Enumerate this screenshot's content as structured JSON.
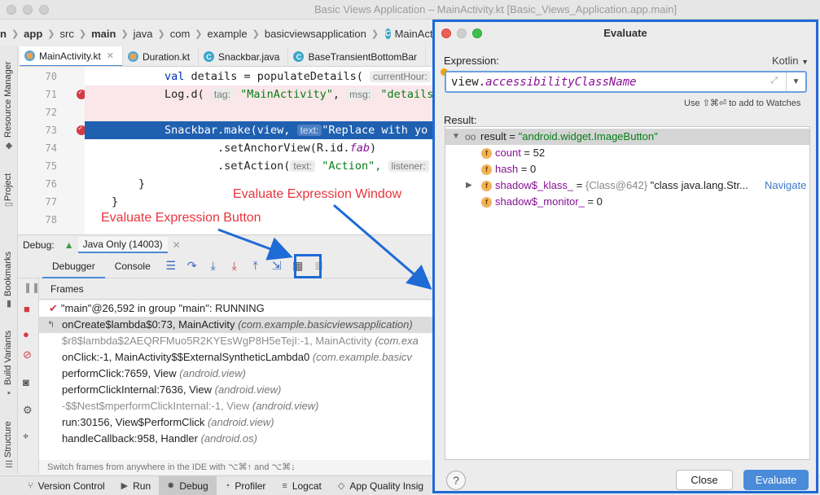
{
  "window": {
    "title": "Basic Views Application – MainActivity.kt [Basic_Views_Application.app.main]"
  },
  "breadcrumb": [
    "n",
    "app",
    "src",
    "main",
    "java",
    "com",
    "example",
    "basicviewsapplication",
    "MainActivity"
  ],
  "tabs": [
    {
      "label": "MainActivity.kt",
      "icon": "kotlin-file-icon",
      "active": true
    },
    {
      "label": "Duration.kt",
      "icon": "kotlin-file-icon",
      "active": false
    },
    {
      "label": "Snackbar.java",
      "icon": "class-icon",
      "active": false
    },
    {
      "label": "BaseTransientBottomBar",
      "icon": "class-icon",
      "active": false
    }
  ],
  "left_tools": [
    "Resource Manager",
    "Project",
    "Bookmarks",
    "Build Variants",
    "Structure"
  ],
  "code": {
    "line_numbers": [
      "70",
      "71",
      "72",
      "73",
      "74",
      "75",
      "76",
      "77",
      "78"
    ],
    "l70": {
      "kw": "val",
      "text": " details = populateDetails(",
      "hint": "currentHour:"
    },
    "l71": {
      "text": "Log.d(",
      "hint1": "tag:",
      "str": "\"MainActivity\"",
      "comma": ",",
      "hint2": "msg:",
      "str2": "\"details ="
    },
    "l73": {
      "text": "Snackbar.make(view,",
      "hint": "text:",
      "str": "\"Replace with yo"
    },
    "l74": {
      "text": ".setAnchorView(R.id.",
      "ital": "fab",
      "close": ")"
    },
    "l75": {
      "text": ".setAction(",
      "hint": "text:",
      "str": "\"Action\",",
      "hint2": "listener:"
    },
    "l76": {
      "text": "}"
    },
    "l77": {
      "text": "}"
    }
  },
  "debug": {
    "label": "Debug:",
    "config": "Java Only (14003)",
    "tab_debugger": "Debugger",
    "tab_console": "Console",
    "frames_label": "Frames",
    "thread": "\"main\"@26,592 in group \"main\": RUNNING",
    "frames": [
      {
        "method": "onCreate$lambda$0:73, MainActivity",
        "loc": "(com.example.basicviewsapplication)",
        "style": "sel"
      },
      {
        "method": "$r8$lambda$2AEQRFMuo5R2KYEsWgP8H5eTejI:-1, MainActivity",
        "loc": "(com.exa",
        "style": "dim"
      },
      {
        "method": "onClick:-1, MainActivity$$ExternalSyntheticLambda0",
        "loc": "(com.example.basicv",
        "style": ""
      },
      {
        "method": "performClick:7659, View",
        "loc": "(android.view)",
        "style": ""
      },
      {
        "method": "performClickInternal:7636, View",
        "loc": "(android.view)",
        "style": ""
      },
      {
        "method": "-$$Nest$mperformClickInternal:-1, View",
        "loc": "(android.view)",
        "style": "dim"
      },
      {
        "method": "run:30156, View$PerformClick",
        "loc": "(android.view)",
        "style": ""
      },
      {
        "method": "handleCallback:958, Handler",
        "loc": "(android.os)",
        "style": ""
      }
    ],
    "hint": "Switch frames from anywhere in the IDE with ⌥⌘↑ and ⌥⌘↓"
  },
  "statusbar": [
    "Version Control",
    "Run",
    "Debug",
    "Profiler",
    "Logcat",
    "App Quality Insig"
  ],
  "annotations": {
    "window": "Evaluate Expression Window",
    "button": "Evaluate Expression Button"
  },
  "dialog": {
    "title": "Evaluate",
    "expression_label": "Expression:",
    "language": "Kotlin",
    "expression_prefix": "view.",
    "expression_ident": "accessibilityClassName",
    "watch_hint": "Use ⇧⌘⏎ to add to Watches",
    "result_label": "Result:",
    "result": {
      "name": "result",
      "eq": " = ",
      "value": "\"android.widget.ImageButton\"",
      "fields": [
        {
          "name": "count",
          "value": " = 52"
        },
        {
          "name": "hash",
          "value": " = 0"
        },
        {
          "name": "shadow$_klass_",
          "eq": " = ",
          "ref": "{Class@642}",
          "value": " \"class java.lang.Str...",
          "link": "Navigate"
        },
        {
          "name": "shadow$_monitor_",
          "value": " = 0"
        }
      ]
    },
    "close_label": "Close",
    "evaluate_label": "Evaluate",
    "help_label": "?"
  },
  "colors": {
    "accent": "#1e6bd6",
    "annotation": "#e8343c",
    "primary_button": "#4a8bd9"
  }
}
